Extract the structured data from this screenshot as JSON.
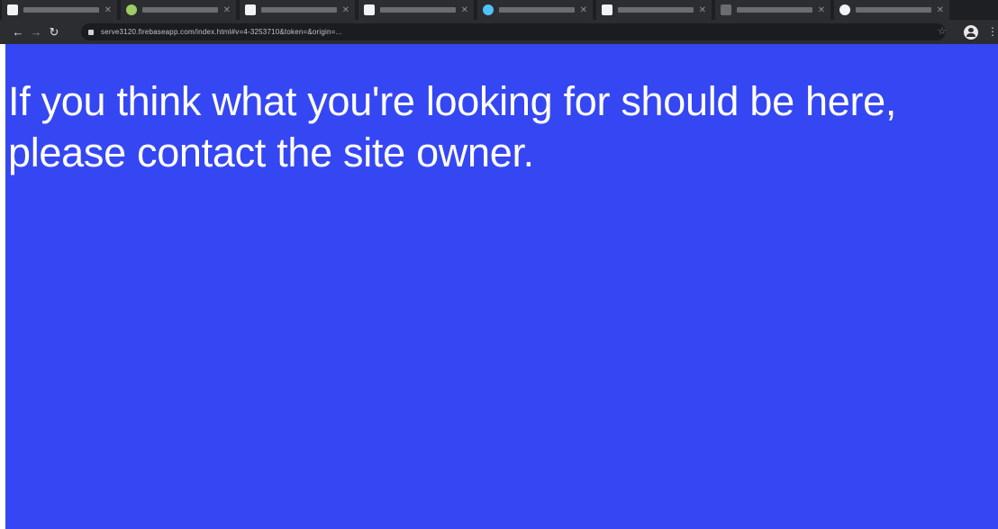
{
  "browser": {
    "tabs": [
      {
        "favicon_color": "#f1f3f4"
      },
      {
        "favicon_color": "#9ccc65"
      },
      {
        "favicon_color": "#f1f3f4"
      },
      {
        "favicon_color": "#f1f3f4"
      },
      {
        "favicon_color": "#4fc3f7"
      },
      {
        "favicon_color": "#f1f3f4"
      },
      {
        "favicon_color": "#6a6c70"
      },
      {
        "favicon_color": "#f1f3f4"
      }
    ],
    "url": "serve3120.firebaseapp.com/index.html#v=4-3253710&token=&origin=...",
    "icons": {
      "back": "back-arrow-icon",
      "forward": "forward-arrow-icon",
      "reload": "reload-icon",
      "lock": "lock-icon",
      "star": "bookmark-star-icon",
      "profile": "profile-icon",
      "menu": "more-menu-icon"
    }
  },
  "page": {
    "background_color": "#3547f3",
    "message": "If you think what you're looking for should be here, please contact the site owner."
  }
}
